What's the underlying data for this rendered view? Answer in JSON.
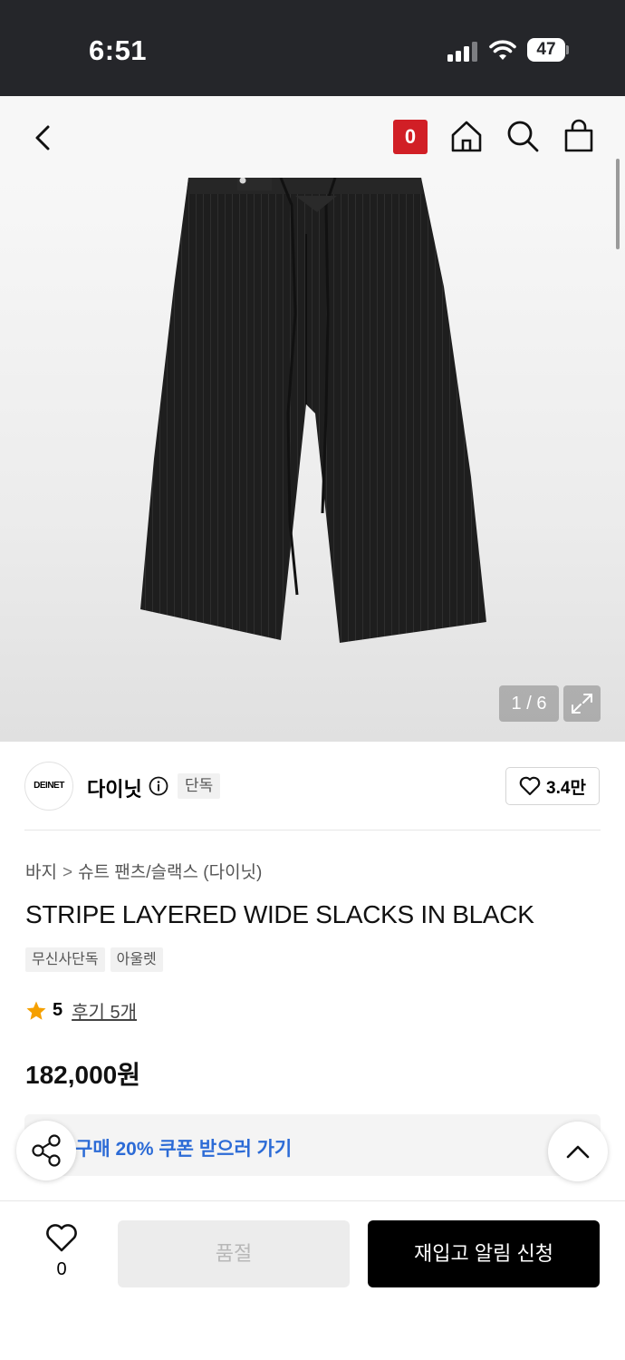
{
  "status_bar": {
    "time": "6:51",
    "battery": "47"
  },
  "header": {
    "back_icon": "chevron-left-icon",
    "notification_badge": "0",
    "icons": [
      "home-icon",
      "search-icon",
      "shopping-bag-icon"
    ],
    "badge_color": "#d11f26"
  },
  "gallery": {
    "counter": "1 / 6",
    "expand_icon": "expand-icon"
  },
  "brand": {
    "logo_text": "DEINET",
    "name": "다이닛",
    "exclusive_tag": "단독",
    "like_count": "3.4만"
  },
  "product": {
    "breadcrumb": [
      "바지",
      "슈트 팬츠/슬랙스 (다이닛)"
    ],
    "title": "STRIPE LAYERED WIDE SLACKS IN BLACK",
    "tags": [
      "무신사단독",
      "아울렛"
    ],
    "rating": "5",
    "review_label": "후기 5개",
    "price": "182,000원",
    "star_color": "#f5a000"
  },
  "coupon": {
    "text": "구매 20% 쿠폰 받으러 가기",
    "color": "#2c6bd6"
  },
  "bottom_bar": {
    "like_count": "0",
    "soldout_label": "품절",
    "restock_label": "재입고 알림 신청"
  }
}
